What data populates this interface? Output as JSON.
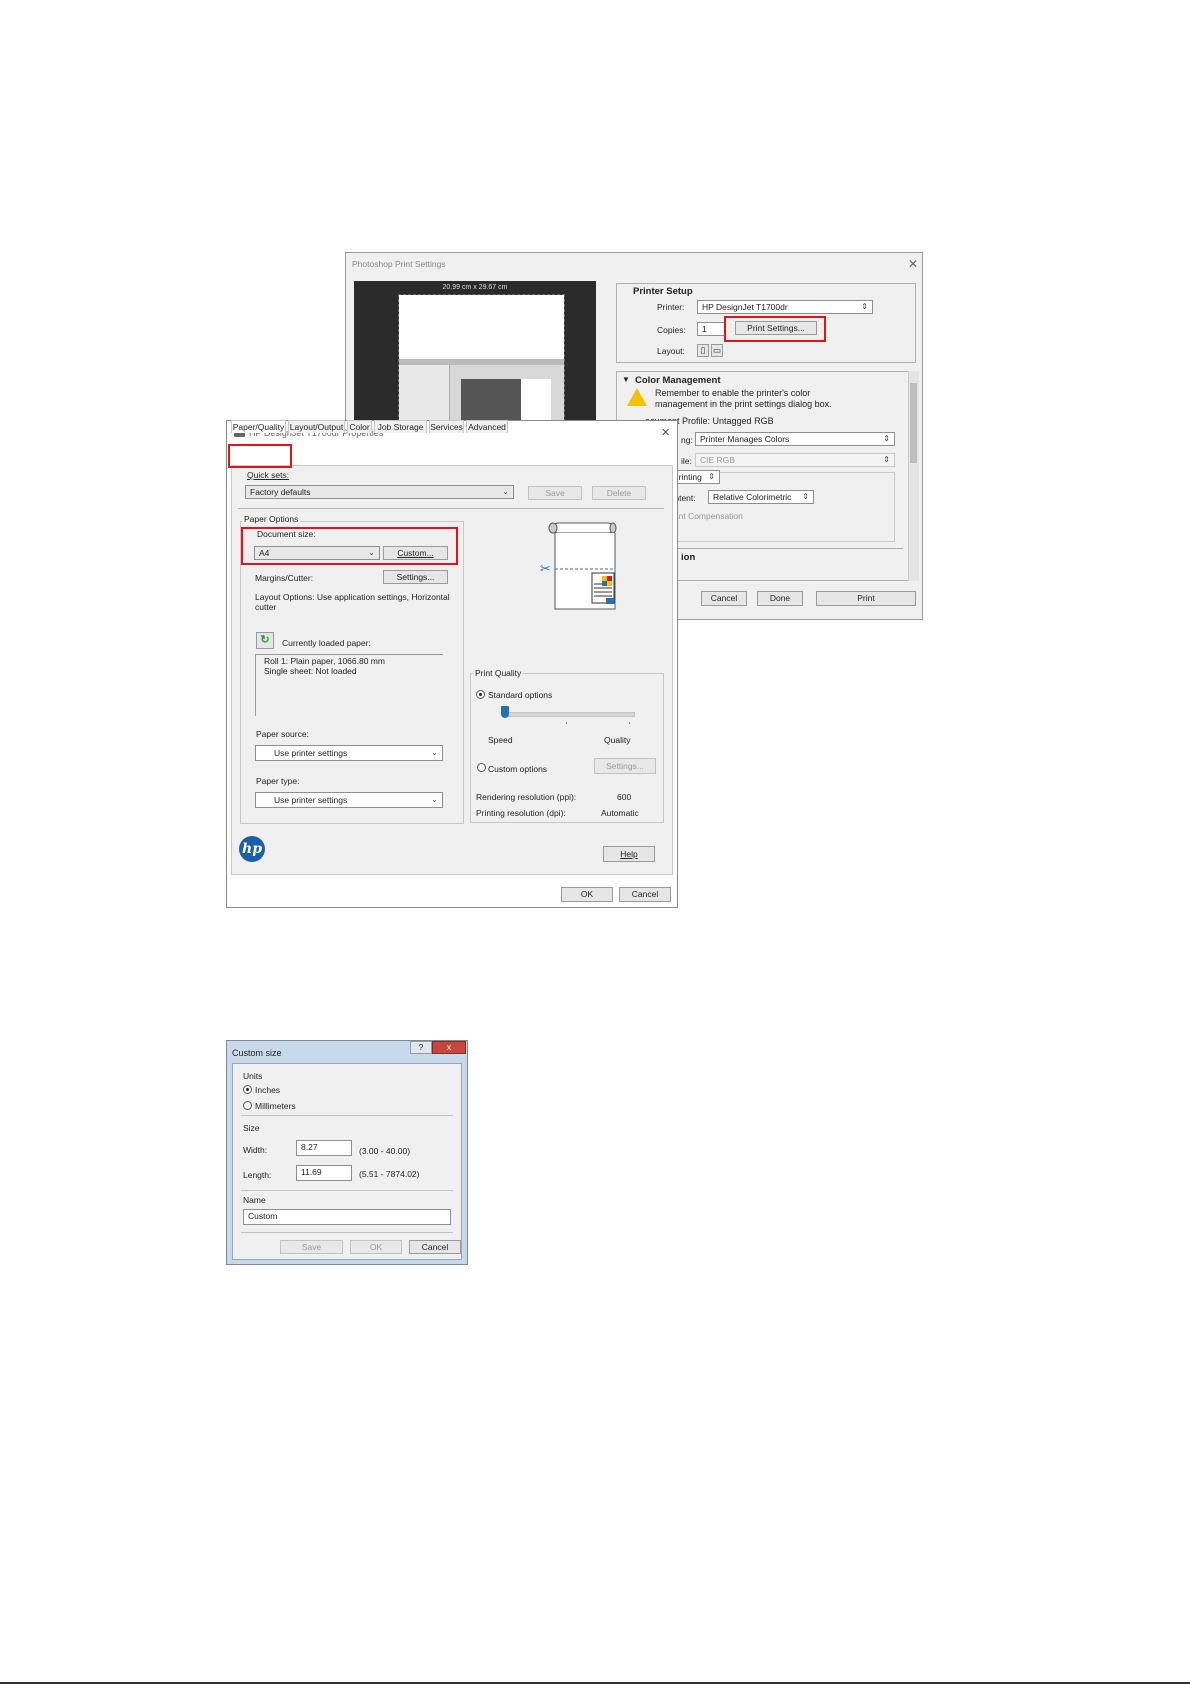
{
  "photoshop": {
    "title": "Photoshop Print Settings",
    "preview_size": "20.99 cm x 29.67 cm",
    "printer_setup": {
      "heading": "Printer Setup",
      "printer_label": "Printer:",
      "printer_value": "HP DesignJet T1700dr",
      "copies_label": "Copies:",
      "copies_value": "1",
      "print_settings_button": "Print Settings...",
      "layout_label": "Layout:"
    },
    "color_management": {
      "heading": "Color Management",
      "warning_line1": "Remember to enable the printer's color",
      "warning_line2": "management in the print settings dialog box.",
      "doc_profile": "ocument Profile: Untagged RGB",
      "color_handling_label": "ng:",
      "color_handling_value": "Printer Manages Colors",
      "printer_profile_label": "ile:",
      "printer_profile_value": "CIE RGB",
      "normal_printing_value": "Printing",
      "intent_label": "Intent:",
      "intent_value": "Relative Colorimetric",
      "bpc_label": "oint Compensation",
      "section_fragment": "ion"
    },
    "buttons": {
      "cancel": "Cancel",
      "done": "Done",
      "print": "Print"
    }
  },
  "hp": {
    "title": "HP DesignJet T1700dr Properties",
    "tabs": [
      "Paper/Quality",
      "Layout/Output",
      "Color",
      "Job Storage",
      "Services",
      "Advanced"
    ],
    "quick_sets_label": "Quick sets:",
    "quick_sets_value": "Factory defaults",
    "save_button": "Save",
    "delete_button": "Delete",
    "paper_options_label": "Paper Options",
    "document_size_label": "Document size:",
    "document_size_value": "A4",
    "custom_button": "Custom...",
    "margins_label": "Margins/Cutter:",
    "settings_button": "Settings...",
    "layout_options_line1": "Layout Options: Use application settings, Horizontal",
    "layout_options_line2": "cutter",
    "loaded_paper_label": "Currently loaded paper:",
    "loaded_paper_line1": "Roll 1: Plain paper, 1066.80 mm",
    "loaded_paper_line2": "Single sheet: Not loaded",
    "paper_source_label": "Paper source:",
    "paper_source_value": "Use printer settings",
    "paper_type_label": "Paper type:",
    "paper_type_value": "Use printer settings",
    "print_quality_label": "Print Quality",
    "standard_options_label": "Standard options",
    "speed_label": "Speed",
    "quality_label": "Quality",
    "quality_slider_level": 0,
    "custom_options_label": "Custom options",
    "pq_settings_button": "Settings...",
    "rendering_label": "Rendering resolution (ppi):",
    "rendering_value": "600",
    "printing_label": "Printing resolution (dpi):",
    "printing_value": "Automatic",
    "help_button": "Help",
    "ok_button": "OK",
    "cancel_button": "Cancel"
  },
  "custom_size": {
    "title": "Custom size",
    "help_glyph": "?",
    "close_glyph": "x",
    "units_label": "Units",
    "inches_label": "Inches",
    "millimeters_label": "Millimeters",
    "selected_unit": "Inches",
    "size_label": "Size",
    "width_label": "Width:",
    "width_value": "8.27",
    "width_range": "(3.00 - 40.00)",
    "length_label": "Length:",
    "length_value": "11.69",
    "length_range": "(5.51 - 7874.02)",
    "name_label": "Name",
    "name_value": "Custom",
    "save_button": "Save",
    "ok_button": "OK",
    "cancel_button": "Cancel"
  },
  "colors": {
    "highlight": "#e0141b",
    "accent_blue": "#2a6ebb"
  }
}
